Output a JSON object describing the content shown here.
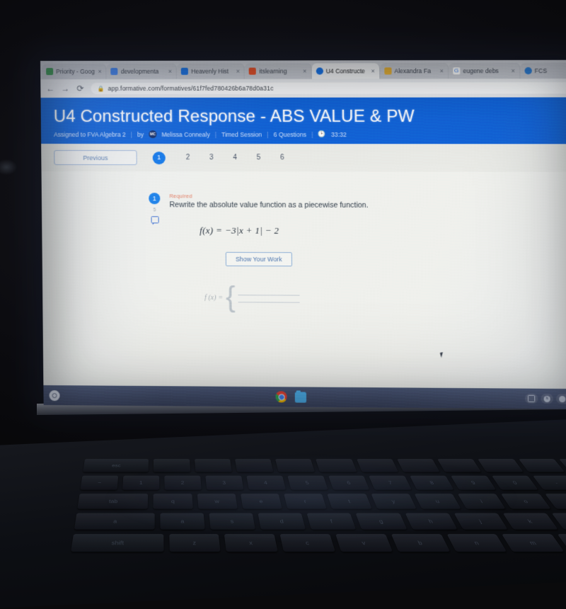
{
  "browser": {
    "tabs": [
      {
        "label": "Priority - Goog",
        "icon": "drive-icon",
        "color": "#3c9b54",
        "active": false
      },
      {
        "label": "developmenta",
        "icon": "docs-icon",
        "color": "#4285f4",
        "active": false
      },
      {
        "label": "Heavenly Hist",
        "icon": "slides-icon",
        "color": "#1a73e8",
        "active": false
      },
      {
        "label": "itslearning",
        "icon": "itslearning-icon",
        "color": "#e8502a",
        "active": false
      },
      {
        "label": "U4 Constructe",
        "icon": "formative-icon",
        "color": "#1a73e8",
        "active": true
      },
      {
        "label": "Alexandra Fa",
        "icon": "page-icon",
        "color": "#e8b23a",
        "active": false
      },
      {
        "label": "eugene debs",
        "icon": "google-icon",
        "color": "#4285f4",
        "active": false
      },
      {
        "label": "FCS",
        "icon": "cloud-icon",
        "color": "#2f7fd6",
        "active": false
      }
    ],
    "tab_close_label": "×",
    "nav": {
      "back": "←",
      "forward": "→",
      "reload": "⟳"
    },
    "omnibox": {
      "lock_icon": "lock-icon",
      "url": "app.formative.com/formatives/61f7fed780426b6a78d0a31c"
    }
  },
  "assignment": {
    "title": "U4 Constructed Response - ABS VALUE & PW",
    "assigned_to": "Assigned to FVA Algebra 2",
    "by_label": "by",
    "teacher_initials": "MC",
    "teacher": "Melissa Connealy",
    "session_type": "Timed Session",
    "question_count": "6 Questions",
    "timer": "33:32",
    "header_color": "#1263d8"
  },
  "pagination": {
    "previous_label": "Previous",
    "pages": [
      "1",
      "2",
      "3",
      "4",
      "5",
      "6"
    ],
    "active_page": "1",
    "active_color": "#1578e8"
  },
  "question": {
    "number": "1",
    "points": "5",
    "required_label": "Required",
    "required_color": "#e2795e",
    "prompt": "Rewrite the absolute value function as a piecewise function.",
    "formula": "f(x) = −3|x + 1| − 2",
    "show_work_label": "Show Your Work",
    "answer_prefix": "f (x) =",
    "answer_brace": "{"
  },
  "shelf": {
    "launcher": "launcher-icon",
    "apps": [
      "chrome-icon",
      "files-icon"
    ],
    "tray": [
      "screen-capture-icon",
      "network-icon",
      "battery-icon",
      "clock-icon"
    ]
  }
}
